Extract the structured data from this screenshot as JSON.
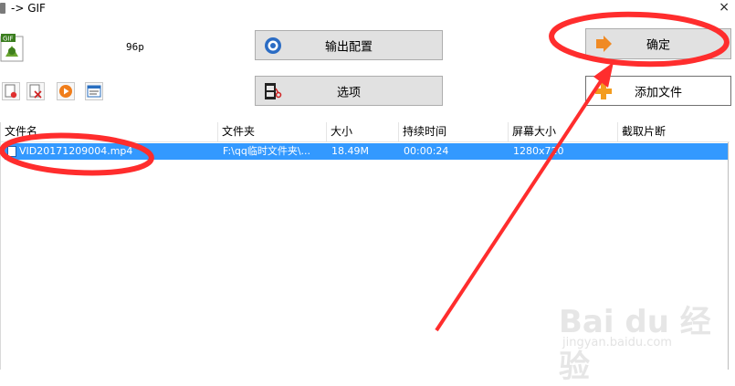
{
  "window": {
    "title": "-> GIF",
    "close": "×"
  },
  "format": {
    "icon_text": "GIF",
    "label": "96p"
  },
  "buttons": {
    "output_config": "输出配置",
    "options": "选项",
    "ok": "确定",
    "add_file": "添加文件"
  },
  "table": {
    "columns": [
      "文件名",
      "文件夹",
      "大小",
      "持续时间",
      "屏幕大小",
      "截取片断"
    ],
    "rows": [
      {
        "name": "VID20171209004.mp4",
        "folder": "F:\\qq临时文件夹\\...",
        "size": "18.49M",
        "duration": "00:00:24",
        "screen": "1280x720",
        "clip": ""
      }
    ]
  },
  "watermark": {
    "brand": "Bai du 经验",
    "url": "jingyan.baidu.com"
  },
  "colors": {
    "selection": "#3399ff",
    "annotation": "#ff2d2d"
  }
}
